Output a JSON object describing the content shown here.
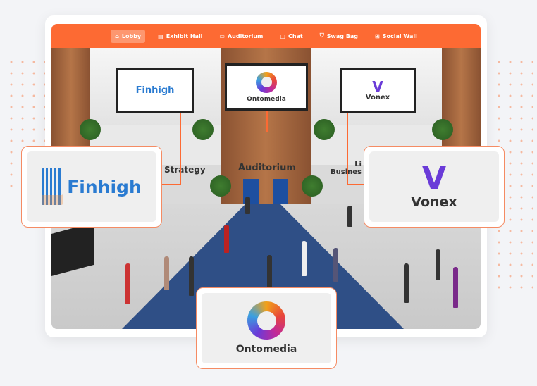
{
  "nav": {
    "items": [
      {
        "label": "Lobby",
        "icon": "home-icon",
        "active": true
      },
      {
        "label": "Exhibit Hall",
        "icon": "booth-icon"
      },
      {
        "label": "Auditorium",
        "icon": "laptop-icon"
      },
      {
        "label": "Chat",
        "icon": "chat-icon"
      },
      {
        "label": "Swag Bag",
        "icon": "bag-icon"
      },
      {
        "label": "Social Wall",
        "icon": "grid-icon"
      }
    ]
  },
  "screens": {
    "left": "Finhigh",
    "center": "Ontomedia",
    "right": "Vonex"
  },
  "signs": {
    "left": "Strategy",
    "center": "Auditorium",
    "right_top": "Li",
    "right_bottom": "Busines"
  },
  "callouts": {
    "finhigh": "Finhigh",
    "vonex": "Vonex",
    "ontomedia": "Ontomedia"
  },
  "colors": {
    "accent": "#fd6a33",
    "carpet": "#2f4f86",
    "finhigh": "#2a7bd1",
    "vonex": "#6a3bd8"
  }
}
